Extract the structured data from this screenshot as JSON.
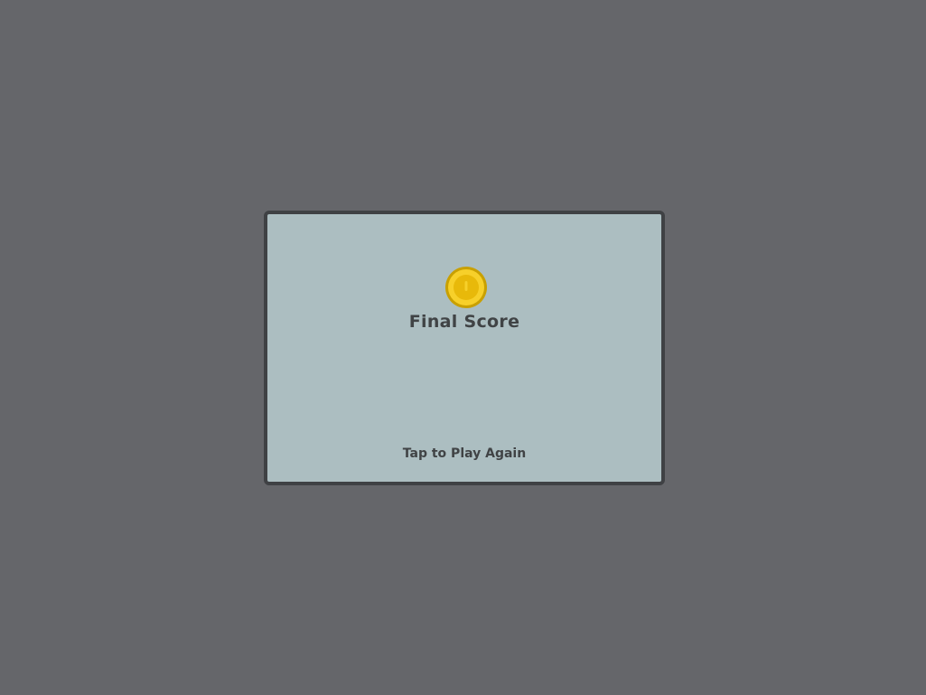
{
  "game_over_panel": {
    "title": "Final Score",
    "coin_icon": "coin-icon",
    "play_again_label": "Tap to Play Again"
  },
  "colors": {
    "background": "#65666a",
    "panel": "#acbec1",
    "panel_border": "#3f4144",
    "text": "#404345",
    "coin_outer": "#d9a900",
    "coin_inner": "#f5c518"
  }
}
